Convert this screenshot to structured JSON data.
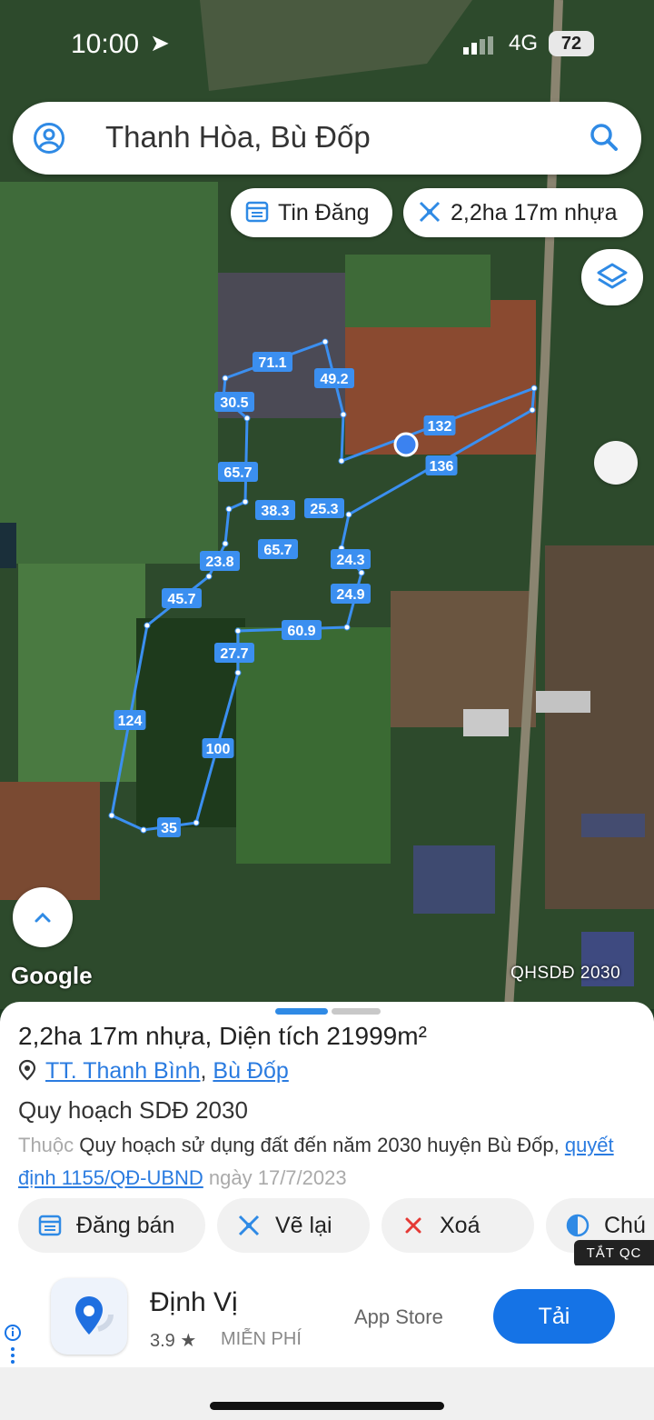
{
  "status_bar": {
    "time": "10:00",
    "network": "4G",
    "battery": "72"
  },
  "search": {
    "query": "Thanh Hòa, Bù Đốp"
  },
  "chips": {
    "listing_label": "Tin Đăng",
    "plot_label": "2,2ha 17m nhựa"
  },
  "map": {
    "google_label": "Google",
    "layer_label": "QHSDĐ 2030",
    "measurements": [
      "71.1",
      "49.2",
      "30.5",
      "132",
      "136",
      "65.7",
      "38.3",
      "25.3",
      "65.7",
      "23.8",
      "24.3",
      "24.9",
      "45.7",
      "60.9",
      "27.7",
      "124",
      "100",
      "35"
    ]
  },
  "sheet": {
    "title": "2,2ha 17m nhựa, Diện tích 21999m²",
    "location_commune": "TT. Thanh Bình",
    "location_separator": ", ",
    "location_district": "Bù Đốp",
    "plan_title": "Quy hoạch SDĐ 2030",
    "desc_prefix": "Thuộc ",
    "desc_main": "Quy hoạch sử dụng đất đến năm 2030 huyện Bù Đốp",
    "desc_comma": ", ",
    "desc_link": "quyết định 1155/QĐ-UBND",
    "desc_date": " ngày 17/7/2023"
  },
  "actions": {
    "post_sale": "Đăng bán",
    "redraw": "Vẽ lại",
    "delete": "Xoá",
    "note": "Chú"
  },
  "ad": {
    "close_label": "TẮT QC",
    "app_name": "Định Vị",
    "rating": "3.9 ★",
    "price": "MIỄN PHÍ",
    "store": "App Store",
    "cta": "Tải"
  },
  "colors": {
    "accent": "#2f8ae5",
    "cta": "#1573e6",
    "delete": "#e53935",
    "polygon": "#3b8ff0"
  }
}
